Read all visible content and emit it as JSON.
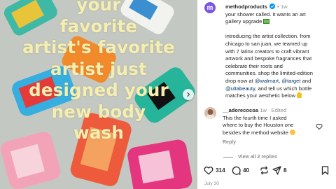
{
  "media": {
    "overlay_lines": [
      "your",
      "favorite",
      "artist's favorite",
      "artist just",
      "designed your",
      "new body",
      "wash"
    ],
    "next_icon": "chevron-right-icon"
  },
  "post": {
    "avatar_letter": "m",
    "username": "methodproducts",
    "separator": "•",
    "time": "1w",
    "caption_lines": [
      "your shower called. it wants an art",
      "gallery upgrade",
      "",
      "introducing the artist collection. from",
      "chicago to san juan, we teamed up",
      "with 7 latinx creators to craft vibrant",
      "artwork and bespoke fragrances that",
      "celebrate their roots and",
      "communities. shop the limited-edition",
      "drop now at",
      "and",
      "and tell us which bottle",
      "matches your aesthetic below"
    ],
    "mentions": [
      "@walmart",
      "@target",
      "@ultabeauty"
    ],
    "comma": ","
  },
  "comment": {
    "username": "__adorecocoa",
    "time": "1w",
    "edited": "Edited",
    "lines": [
      "This the fourth time I asked",
      "where to buy the Houston one",
      "besides the method website"
    ],
    "reply_label": "Reply",
    "view_replies": "View all 2 replies"
  },
  "actions": {
    "likes": "314",
    "comments": "40",
    "shares": "8"
  },
  "date": "July 30",
  "colors": {
    "overlay_text": "#f4eeb0",
    "verified": "#0095f6",
    "link": "#00376b",
    "muted": "#8e8e8e"
  }
}
